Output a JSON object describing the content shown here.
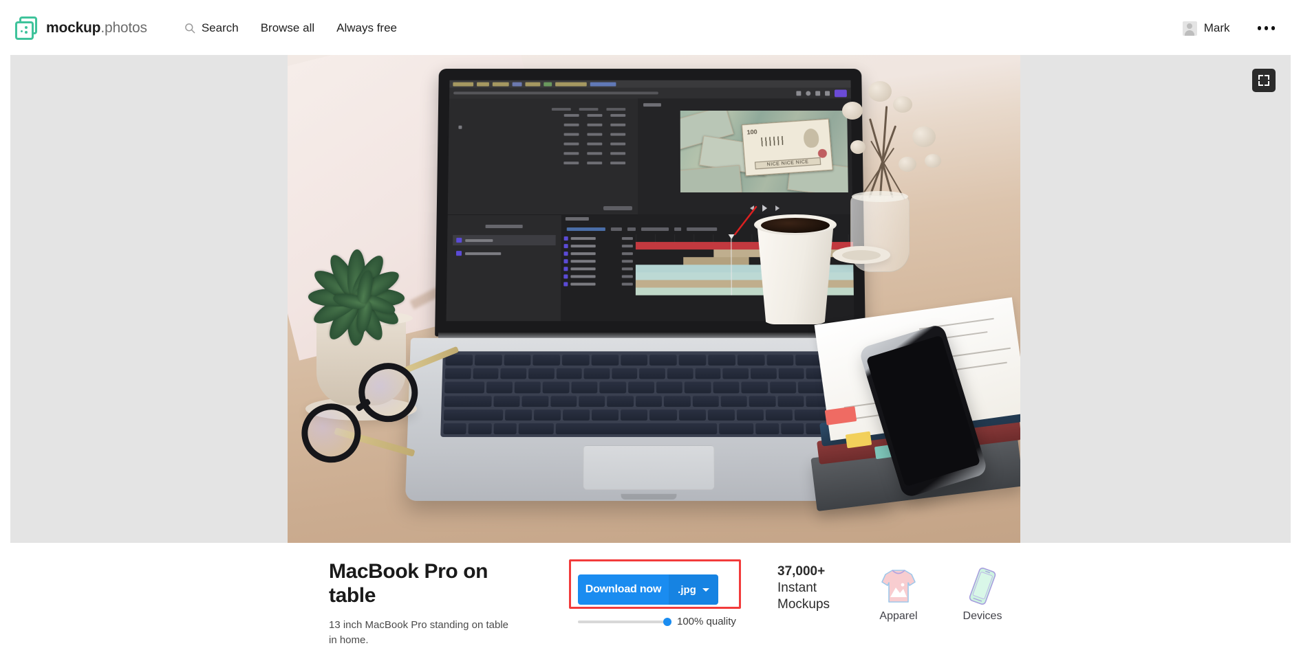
{
  "header": {
    "brand": {
      "bold": "mockup",
      "light": ".photos",
      "logo_icon": "mockup-photos-logo",
      "accent": "#3fc39b"
    },
    "nav": [
      {
        "label": "Search",
        "icon": "search-icon"
      },
      {
        "label": "Browse all",
        "icon": null
      },
      {
        "label": "Always free",
        "icon": null
      }
    ],
    "user": {
      "name": "Mark",
      "avatar_icon": "user-avatar-icon"
    },
    "more_menu_icon": "more-horizontal-icon"
  },
  "viewer": {
    "fullscreen_icon": "fullscreen-expand-icon",
    "background_color": "#e4e4e4",
    "photo_alt": "MacBook Pro on a wooden table with succulent plant, glasses, coffee cup, dried flowers, notebooks and smartphone"
  },
  "details": {
    "title": "MacBook Pro on table",
    "description": "13 inch MacBook Pro standing on table in home."
  },
  "download": {
    "button_label": "Download now",
    "format": ".jpg",
    "format_caret_icon": "chevron-down-icon",
    "quality_label": "100% quality",
    "quality_value": 100,
    "accent_color": "#1a8cf0",
    "format_color": "#1683e2",
    "highlight_color": "#f23b3b"
  },
  "promo": {
    "count": "37,000+",
    "line2": "Instant",
    "line3": "Mockups",
    "items": [
      {
        "label": "Apparel",
        "icon": "tshirt-icon"
      },
      {
        "label": "Devices",
        "icon": "phone-device-icon"
      }
    ]
  }
}
